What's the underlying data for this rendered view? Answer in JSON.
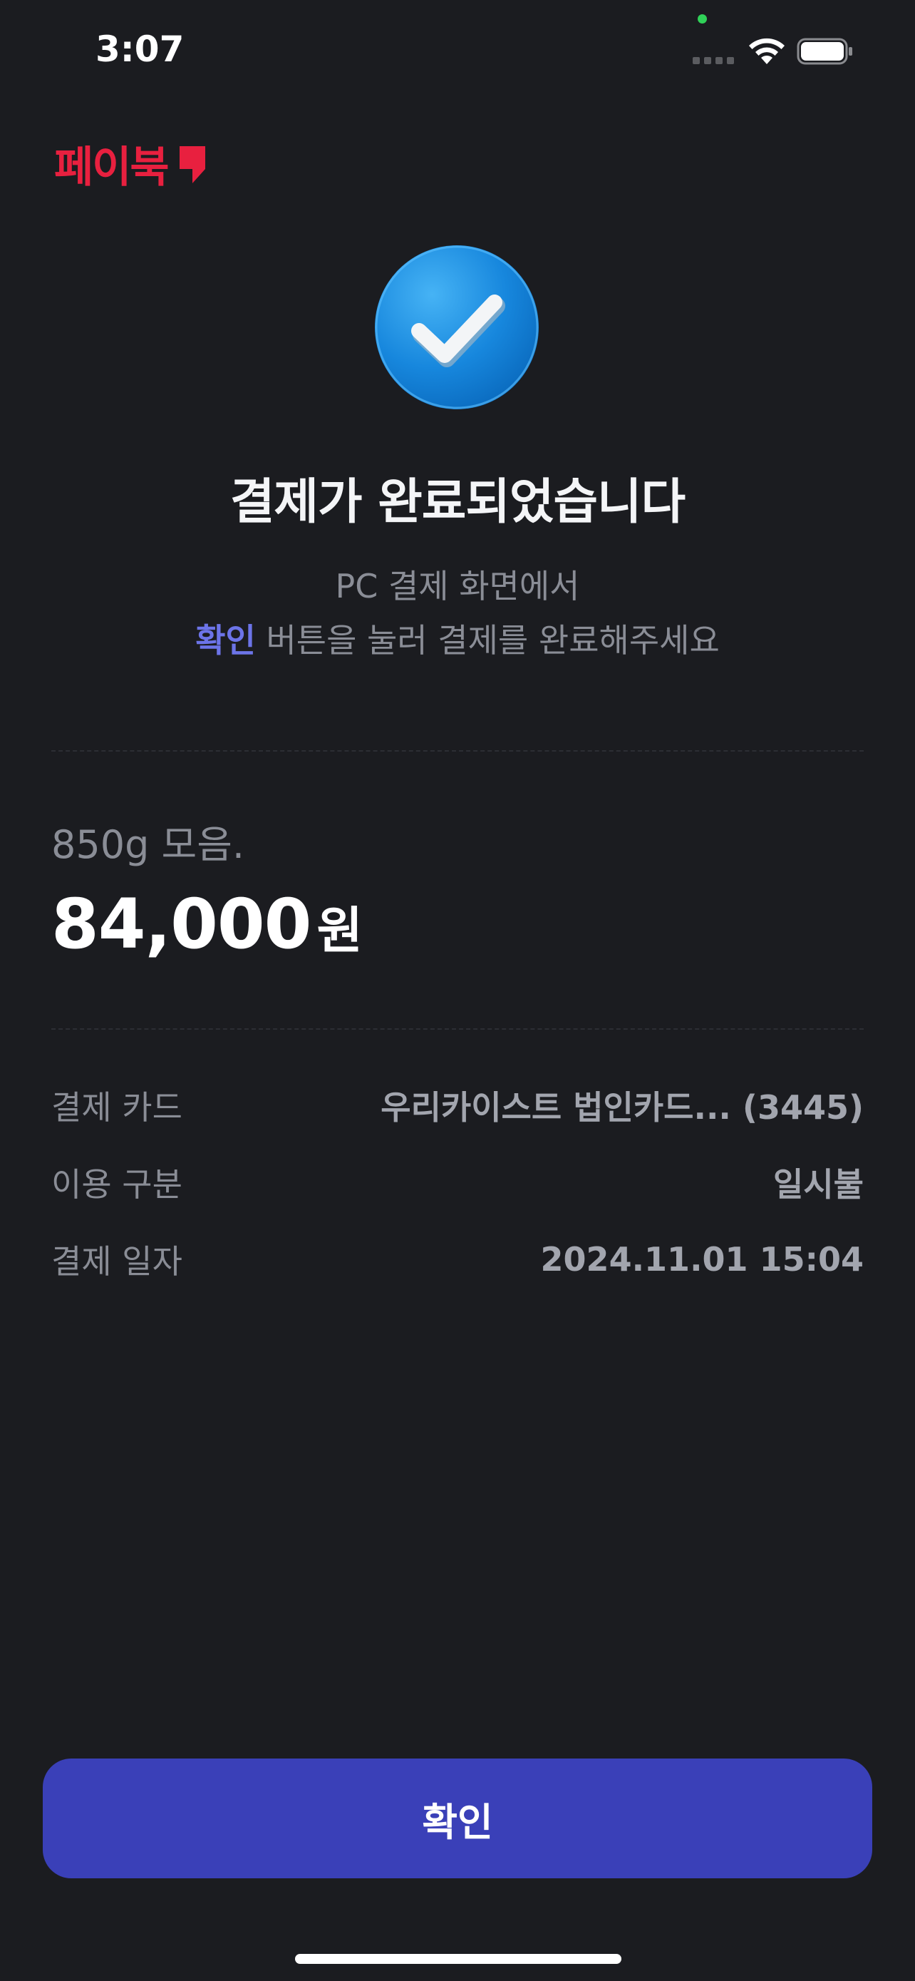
{
  "status_bar": {
    "time": "3:07"
  },
  "brand": {
    "name": "페이북",
    "color": "#e8203f"
  },
  "result": {
    "icon": "checkmark-circle-icon",
    "title": "결제가 완료되었습니다",
    "subtitle_line1": "PC 결제 화면에서",
    "subtitle_accent": "확인",
    "subtitle_line2_rest": " 버튼을 눌러 결제를 완료해주세요"
  },
  "product": {
    "name": "850g 모음.",
    "amount": "84,000",
    "currency_unit": "원"
  },
  "details": [
    {
      "label": "결제 카드",
      "value": "우리카이스트 법인카드... (3445)"
    },
    {
      "label": "이용 구분",
      "value": "일시불"
    },
    {
      "label": "결제 일자",
      "value": "2024.11.01 15:04"
    }
  ],
  "confirm_button": {
    "label": "확인",
    "color": "#3a40b8"
  },
  "colors": {
    "background": "#1b1c20",
    "accent_text": "#6c74e8",
    "muted_text": "#8a8d96"
  }
}
